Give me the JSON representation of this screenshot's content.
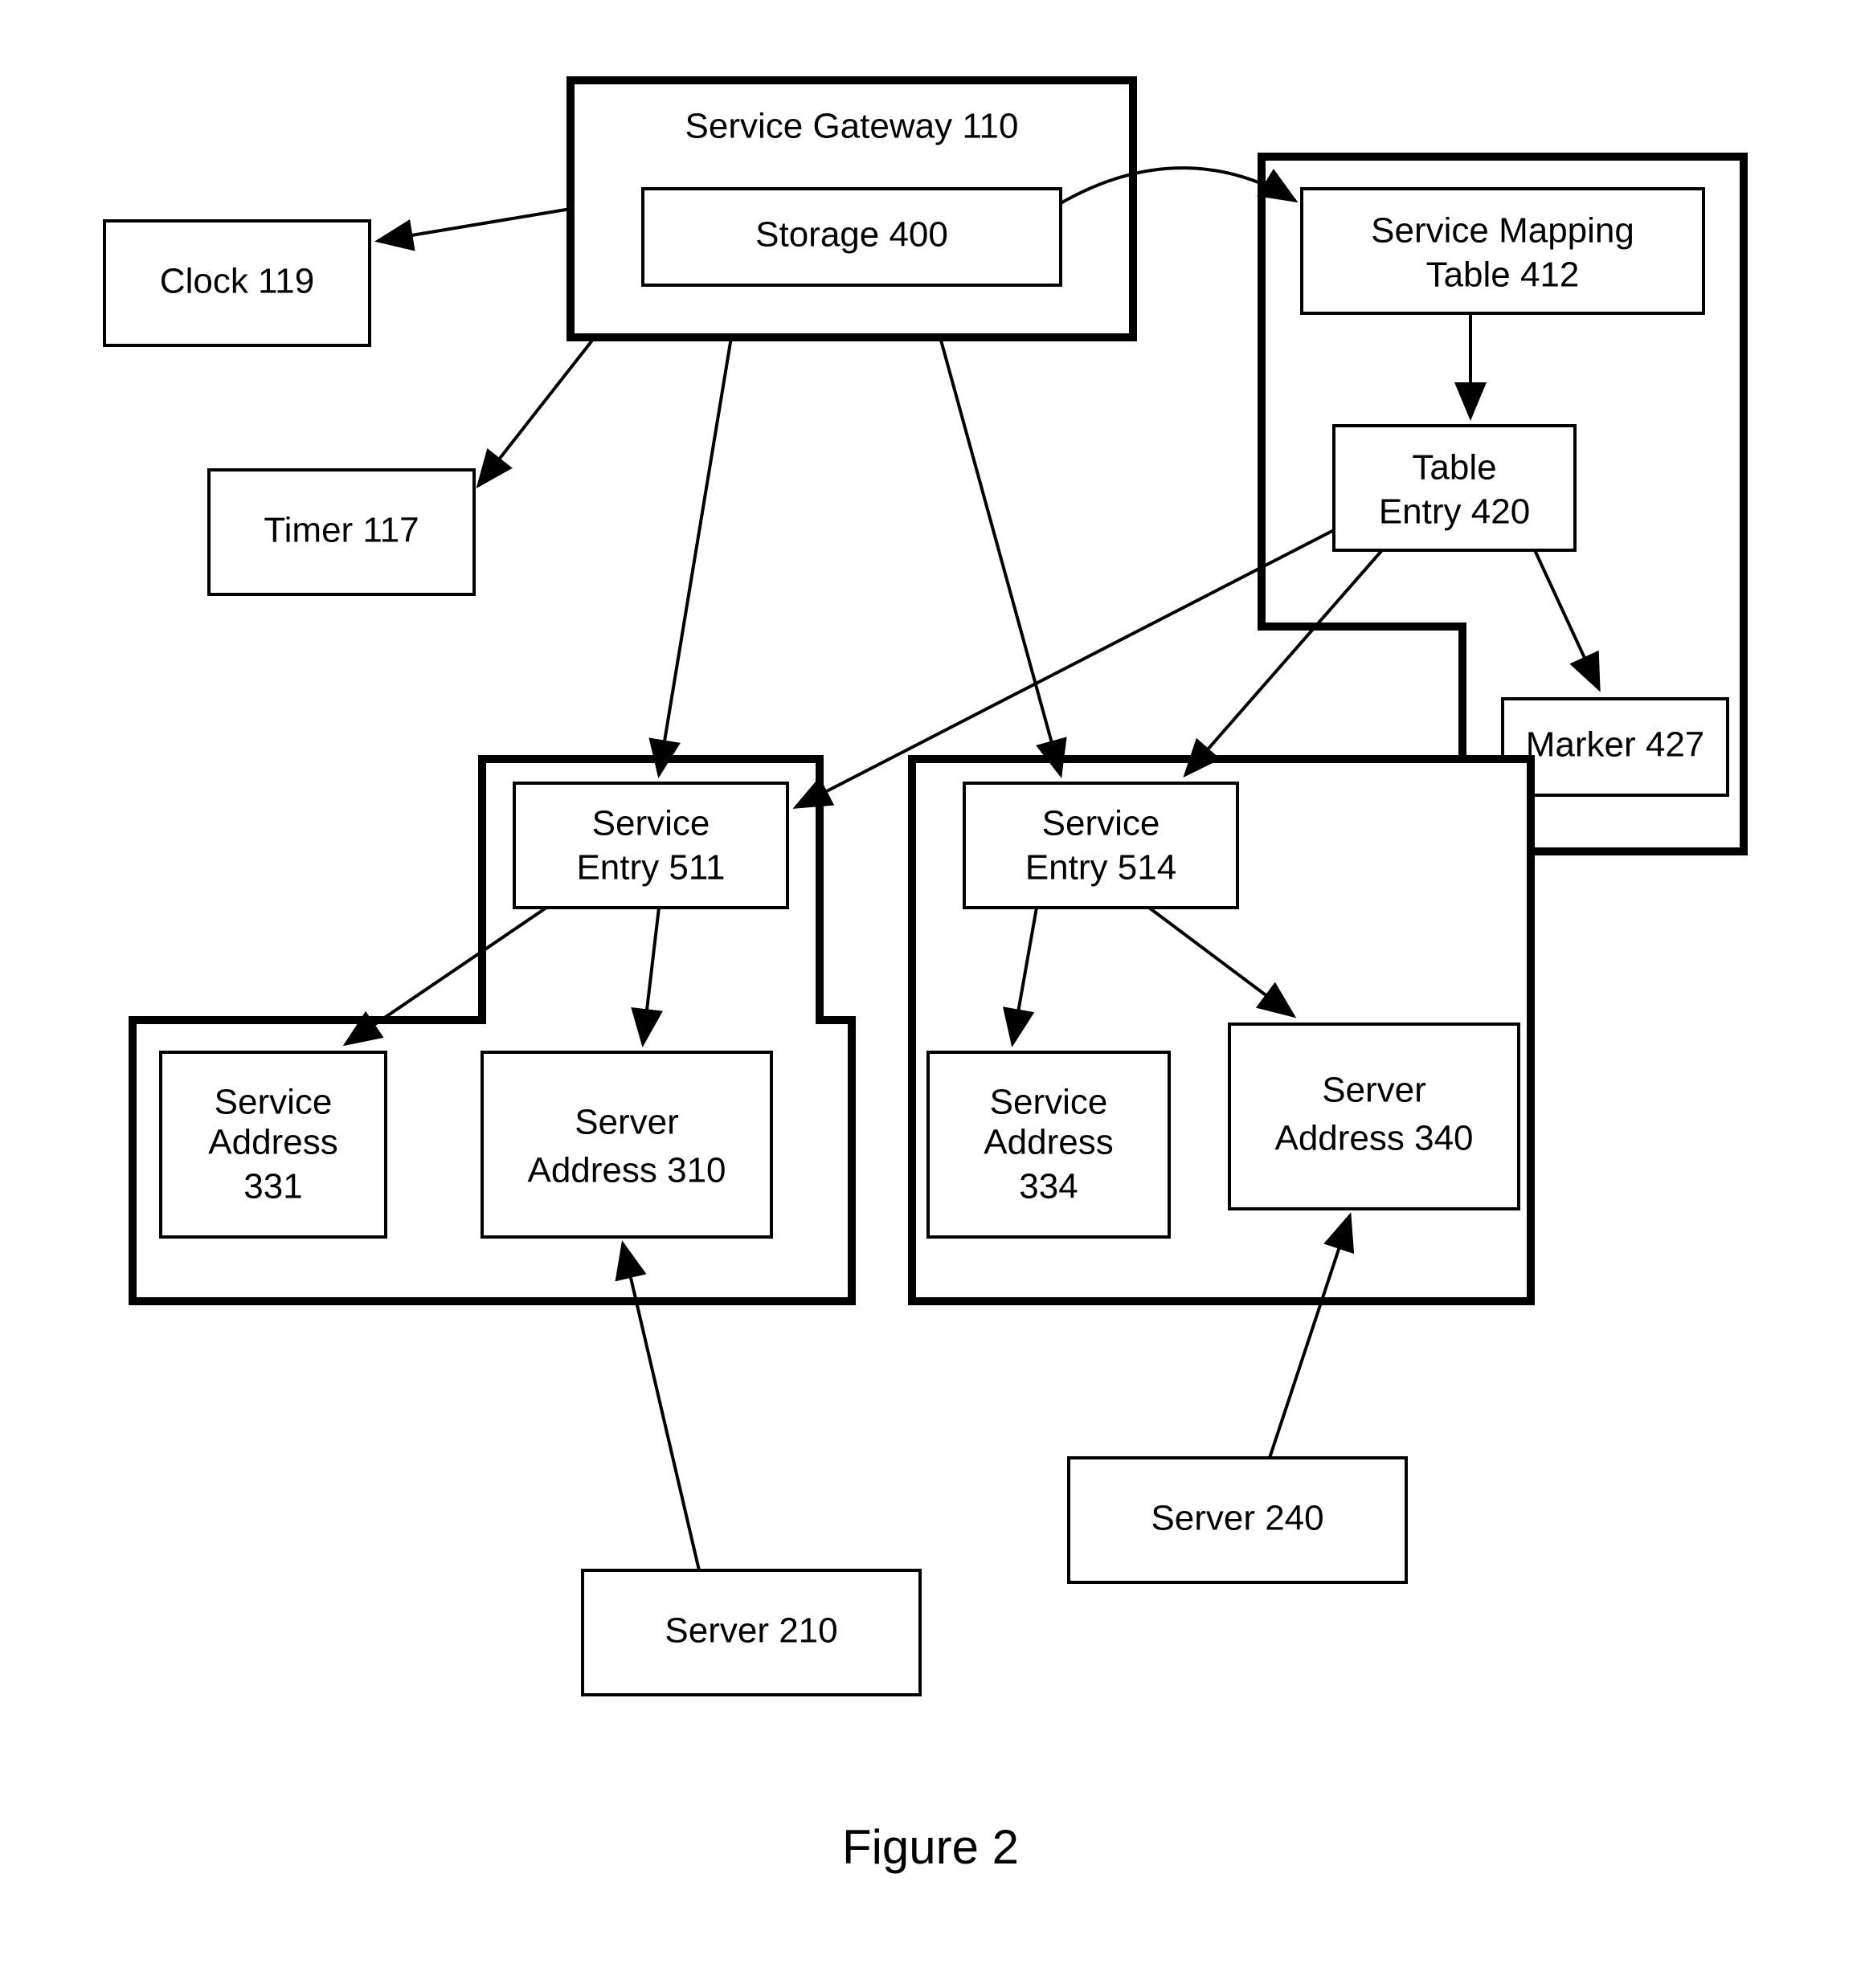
{
  "nodes": {
    "serviceGateway": {
      "label": "Service Gateway 110"
    },
    "storage": {
      "label": "Storage 400"
    },
    "clock": {
      "label": "Clock 119"
    },
    "timer": {
      "label": "Timer 117"
    },
    "mappingTable": {
      "line1": "Service Mapping",
      "line2": "Table 412"
    },
    "tableEntry": {
      "line1": "Table",
      "line2": "Entry 420"
    },
    "marker": {
      "label": "Marker 427"
    },
    "serviceEntry511": {
      "line1": "Service",
      "line2": "Entry 511"
    },
    "serviceEntry514": {
      "line1": "Service",
      "line2": "Entry 514"
    },
    "serviceAddr331": {
      "line1": "Service",
      "line2": "Address",
      "line3": "331"
    },
    "serverAddr310": {
      "line1": "Server",
      "line2": "Address 310"
    },
    "serviceAddr334": {
      "line1": "Service",
      "line2": "Address",
      "line3": "334"
    },
    "serverAddr340": {
      "line1": "Server",
      "line2": "Address 340"
    },
    "server210": {
      "label": "Server 210"
    },
    "server240": {
      "label": "Server 240"
    }
  },
  "caption": "Figure 2"
}
